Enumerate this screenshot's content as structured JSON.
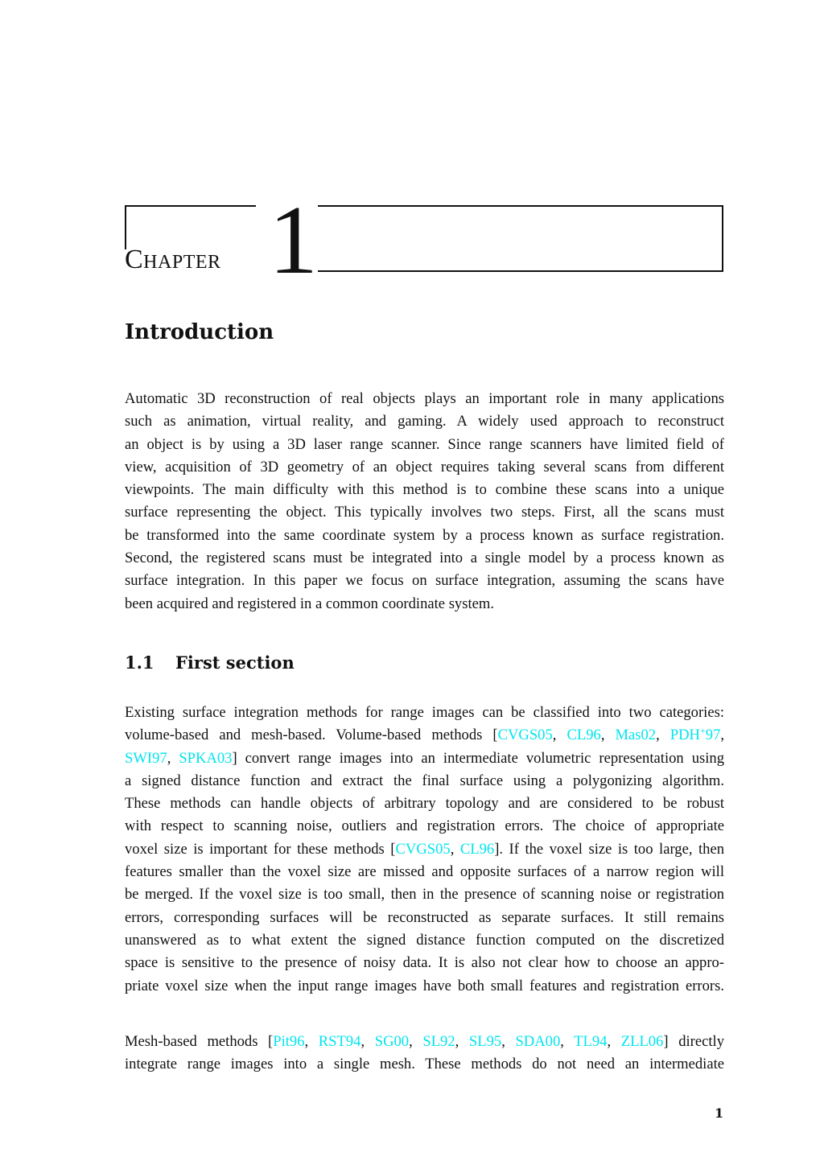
{
  "chapter": {
    "label": "Chapter",
    "number": "1",
    "title": "Introduction"
  },
  "intro_paragraph": {
    "lines": [
      "Automatic 3D reconstruction of real objects plays an important role in many applications",
      "such as animation, virtual reality, and gaming.  A widely used approach to reconstruct",
      "an object is by using a 3D laser range scanner. Since range scanners have limited field of",
      "view, acquisition of 3D geometry of an object requires taking several scans from different",
      "viewpoints. The main difficulty with this method is to combine these scans into a unique",
      "surface representing the object. This typically involves two steps. First, all the scans must",
      "be transformed into the same coordinate system by a process known as surface registration.",
      "Second, the registered scans must be integrated into a single model by a process known as",
      "surface integration. In this paper we focus on surface integration, assuming the scans have",
      "been acquired and registered in a common coordinate system."
    ]
  },
  "section": {
    "number": "1.1",
    "title": "First section"
  },
  "section_paragraph_1": {
    "l1": "Existing surface integration methods for range images can be classified into two categories:",
    "l2_pre": "volume-based and mesh-based. Volume-based methods [",
    "l2_c1": "CVGS05",
    "l2_c2": "CL96",
    "l2_c3": "Mas02",
    "l2_c4_base": "PDH",
    "l2_c4_sup": "+",
    "l2_c4_year": "97",
    "l3_c1": "SWI97",
    "l3_c2": "SPKA03",
    "l3_post": "] convert range images into an intermediate volumetric representation using",
    "l4": "a signed distance function and extract the final surface using a polygonizing algorithm.",
    "l5": "These methods can handle objects of arbitrary topology and are considered to be robust",
    "l6": "with respect to scanning noise, outliers and registration errors. The choice of appropriate",
    "l7_pre": "voxel size is important for these methods [",
    "l7_c1": "CVGS05",
    "l7_c2": "CL96",
    "l7_post": "]. If the voxel size is too large, then",
    "l8": "features smaller than the voxel size are missed and opposite surfaces of a narrow region will",
    "l9": "be merged. If the voxel size is too small, then in the presence of scanning noise or registration",
    "l10": "errors, corresponding surfaces will be reconstructed as separate surfaces.  It still remains",
    "l11": "unanswered as to what extent the signed distance function computed on the discretized",
    "l12": "space is sensitive to the presence of noisy data. It is also not clear how to choose an appro-",
    "l13": "priate voxel size when the input range images have both small features and registration errors."
  },
  "section_paragraph_2": {
    "l1_pre": "Mesh-based methods [",
    "citations": [
      "Pit96",
      "RST94",
      "SG00",
      "SL92",
      "SL95",
      "SDA00",
      "TL94",
      "ZLL06"
    ],
    "l1_post": "] directly",
    "l2": "integrate range images into a single mesh.  These methods do not need an intermediate"
  },
  "footer": {
    "page_number": "1"
  },
  "colors": {
    "citation": "#00e5ee",
    "text": "#111111"
  }
}
